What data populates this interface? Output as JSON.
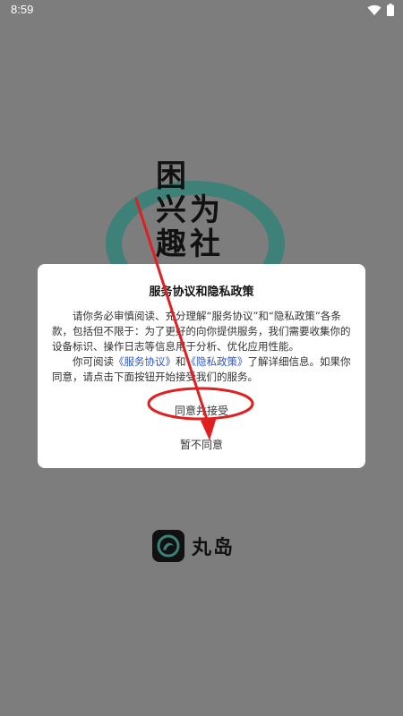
{
  "status_bar": {
    "time": "8:59"
  },
  "splash": {
    "slogan_lines": [
      "困",
      "兴为",
      "趣社"
    ],
    "brand_name": "丸岛"
  },
  "dialog": {
    "title": "服务协议和隐私政策",
    "para1": "请你务必审慎阅读、充分理解“服务协议”和“隐私政策”各条款，包括但不限于：为了更好的向你提供服务，我们需要收集你的设备标识、操作日志等信息用于分析、优化应用性能。",
    "para2_prefix": "你可阅读",
    "service_link": "《服务协议》",
    "and_text": "和",
    "privacy_link": "《隐私政策》",
    "para2_suffix": "了解详细信息。如果你同意，请点击下面按钮开始接受我们的服务。",
    "agree_label": "同意并接受",
    "disagree_label": "暂不同意"
  },
  "colors": {
    "overlay": "#7d7d7d",
    "link": "#2a57d6",
    "annotation": "#e02020",
    "logo_green": "#3a8278"
  },
  "icons": [
    "wifi-icon",
    "battery-icon",
    "brand-mark-icon",
    "annotation-arrow",
    "annotation-ellipse"
  ]
}
